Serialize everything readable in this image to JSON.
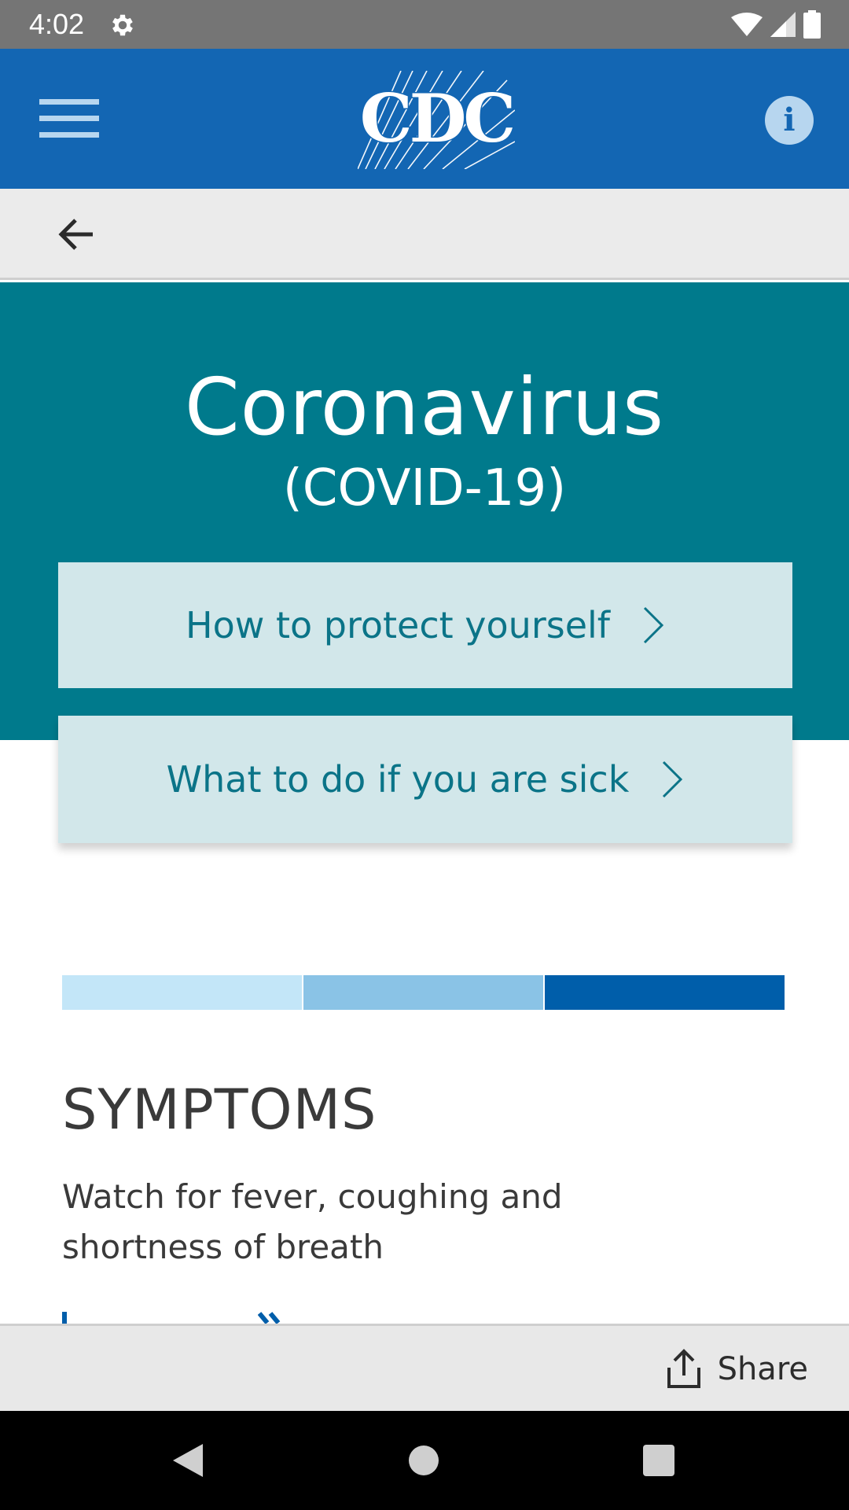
{
  "status_bar": {
    "time": "4:02",
    "icons": [
      "settings-gear-icon",
      "wifi-icon",
      "cell-signal-icon",
      "battery-icon"
    ]
  },
  "app_bar": {
    "logo_text": "CDC",
    "menu_icon": "hamburger-menu-icon",
    "info_icon": "info-icon",
    "info_glyph": "i",
    "background_color": "#1366b3"
  },
  "nav": {
    "back_icon": "arrow-left-icon"
  },
  "hero": {
    "title": "Coronavirus",
    "subtitle": "(COVID-19)",
    "background_color": "#007a8c"
  },
  "actions": [
    {
      "label": "How to protect yourself",
      "icon": "chevron-right-icon"
    },
    {
      "label": "What to do if you are sick",
      "icon": "chevron-right-icon"
    }
  ],
  "symptoms": {
    "strip_colors": [
      "#c3e6f8",
      "#8ac3e6",
      "#005eaa"
    ],
    "title": "SYMPTOMS",
    "text": "Watch for fever, coughing and shortness of breath"
  },
  "share_bar": {
    "label": "Share",
    "icon": "share-icon"
  },
  "system_nav": {
    "icons": [
      "back-triangle-icon",
      "home-circle-icon",
      "recents-square-icon"
    ]
  }
}
